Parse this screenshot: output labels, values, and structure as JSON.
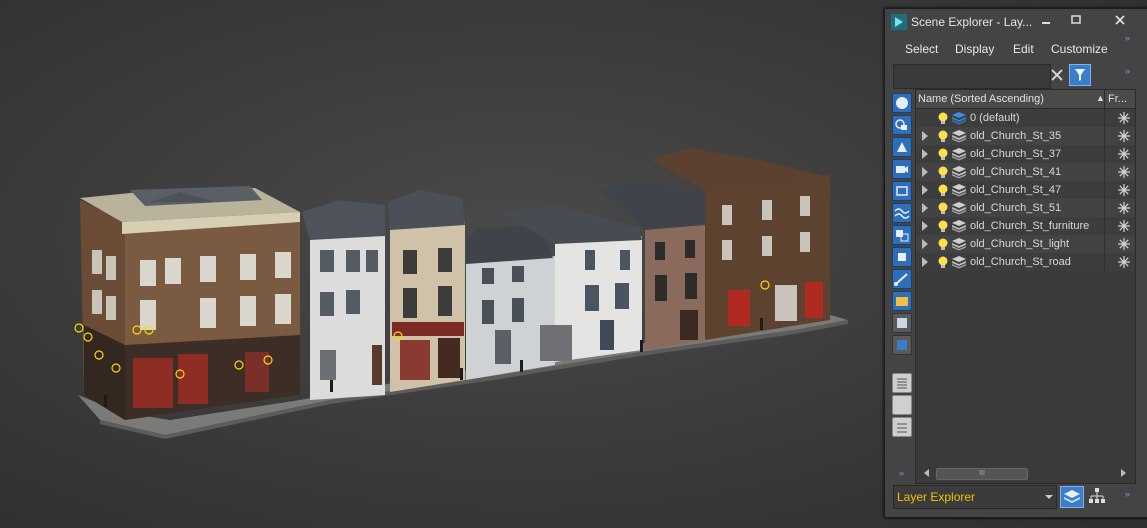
{
  "scene_explorer": {
    "title": "Scene Explorer - Lay...",
    "menu": [
      "Select",
      "Display",
      "Edit",
      "Customize"
    ],
    "search_value": "",
    "columns": {
      "name": "Name (Sorted Ascending)",
      "frozen": "Fr..."
    },
    "layers": [
      {
        "name": "0 (default)",
        "expandable": false,
        "active": true
      },
      {
        "name": "old_Church_St_35",
        "expandable": true
      },
      {
        "name": "old_Church_St_37",
        "expandable": true
      },
      {
        "name": "old_Church_St_41",
        "expandable": true
      },
      {
        "name": "old_Church_St_47",
        "expandable": true
      },
      {
        "name": "old_Church_St_51",
        "expandable": true
      },
      {
        "name": "old_Church_St_furniture",
        "expandable": true
      },
      {
        "name": "old_Church_St_light",
        "expandable": true
      },
      {
        "name": "old_Church_St_road",
        "expandable": true
      }
    ],
    "scroll_thumb_glyph": "III",
    "explorer_selector": "Layer Explorer",
    "more_glyph": "»"
  },
  "colors": {
    "accent_blue": "#3a7dc9",
    "label_yellow": "#f2c200",
    "viewport_bg": "#3d3d3d",
    "panel_bg": "#444444"
  },
  "icons": {
    "app": "3dsmax-icon",
    "bulb": "light-bulb-icon",
    "layer": "layer-stack-icon",
    "freeze": "snowflake-freeze-icon",
    "filter": "filter-icon",
    "clear": "close-icon"
  }
}
